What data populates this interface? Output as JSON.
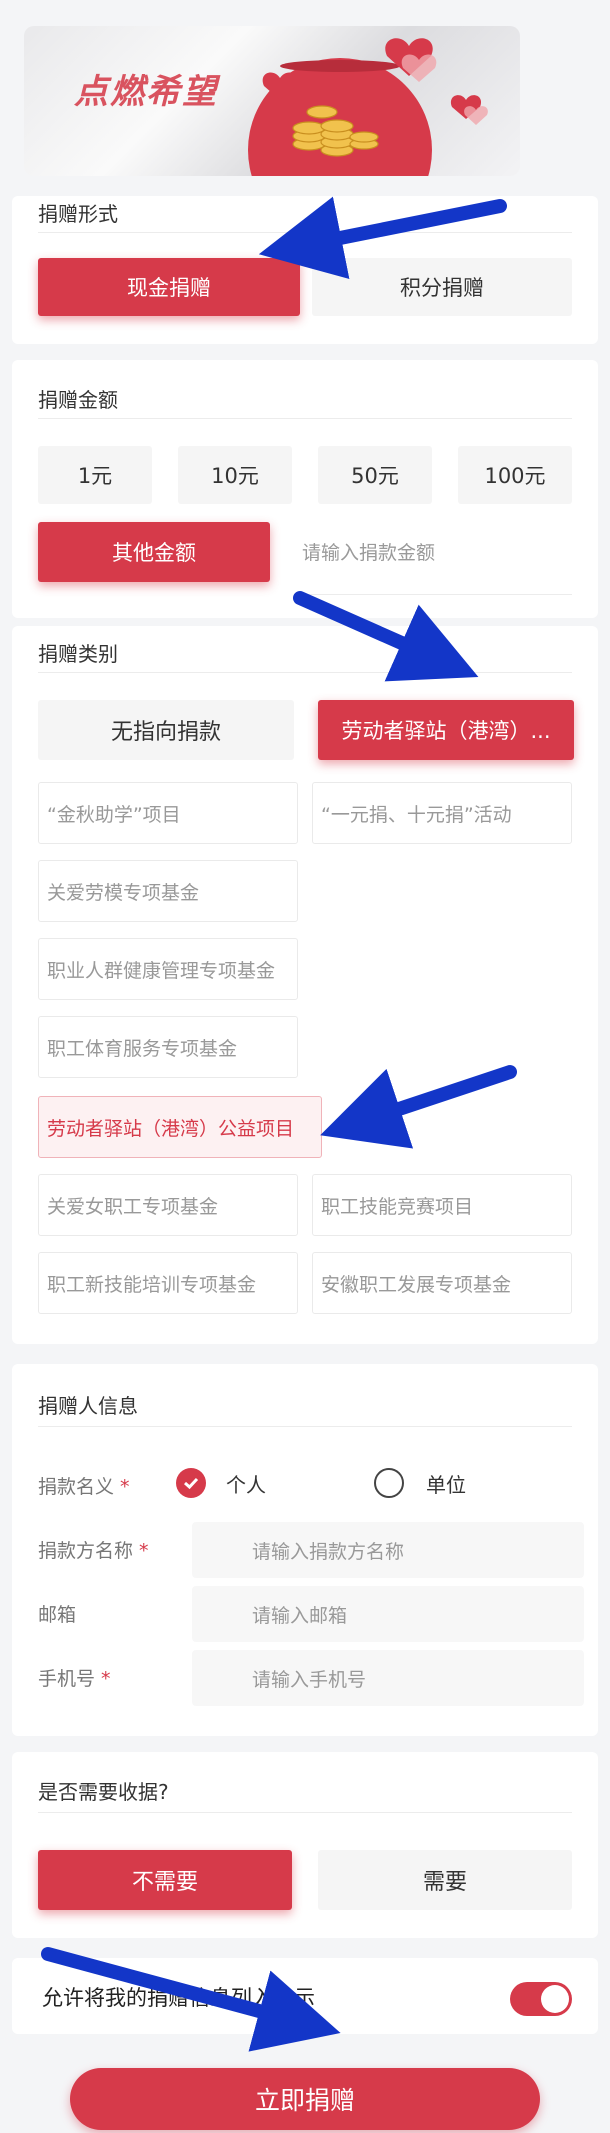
{
  "banner": {
    "title": "点燃希望"
  },
  "donation_form": {
    "title": "捐赠形式",
    "options": [
      "现金捐赠",
      "积分捐赠"
    ],
    "selected": "现金捐赠"
  },
  "amount": {
    "title": "捐赠金额",
    "presets": [
      "1元",
      "10元",
      "50元",
      "100元"
    ],
    "other_label": "其他金额",
    "input_placeholder": "请输入捐款金额"
  },
  "category": {
    "title": "捐赠类别",
    "main_options": [
      "无指向捐款",
      "劳动者驿站（港湾）..."
    ],
    "projects": [
      "“金秋助学”项目",
      "“一元捐、十元捐”活动",
      "关爱劳模专项基金",
      "职业人群健康管理专项基金",
      "职工体育服务专项基金",
      "劳动者驿站（港湾）公益项目",
      "关爱女职工专项基金",
      "职工技能竞赛项目",
      "职工新技能培训专项基金",
      "安徽职工发展专项基金"
    ],
    "selected_project": "劳动者驿站（港湾）公益项目"
  },
  "donor": {
    "title": "捐赠人信息",
    "name_type_label": "捐款名义",
    "required_mark": "*",
    "name_type_options": [
      "个人",
      "单位"
    ],
    "name_type_selected": "个人",
    "donor_name_label": "捐款方名称",
    "donor_name_placeholder": "请输入捐款方名称",
    "email_label": "邮箱",
    "email_placeholder": "请输入邮箱",
    "phone_label": "手机号",
    "phone_placeholder": "请输入手机号"
  },
  "receipt": {
    "title": "是否需要收据?",
    "options": [
      "不需要",
      "需要"
    ],
    "selected": "不需要"
  },
  "publicity": {
    "label": "允许将我的捐赠信息列入公示",
    "enabled": true
  },
  "submit": {
    "label": "立即捐赠"
  },
  "colors": {
    "accent": "#d63a4a",
    "annotation_arrow": "#1336c8"
  }
}
